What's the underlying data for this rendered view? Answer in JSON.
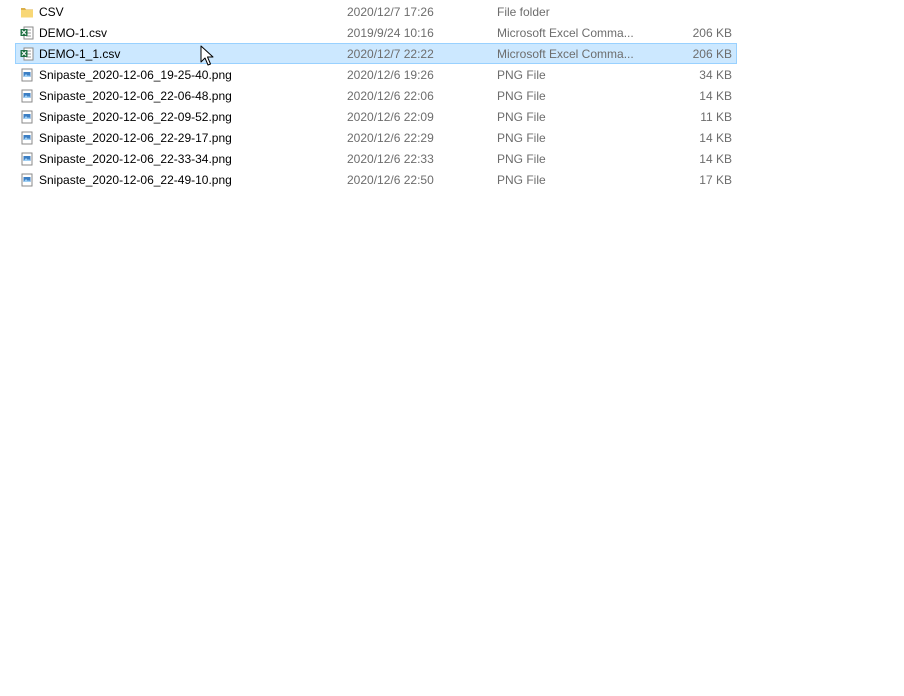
{
  "files": [
    {
      "name": "CSV",
      "date": "2020/12/7 17:26",
      "type": "File folder",
      "size": "",
      "icon": "folder-icon",
      "selected": false
    },
    {
      "name": "DEMO-1.csv",
      "date": "2019/9/24 10:16",
      "type": "Microsoft Excel Comma...",
      "size": "206 KB",
      "icon": "excel-csv-icon",
      "selected": false
    },
    {
      "name": "DEMO-1_1.csv",
      "date": "2020/12/7 22:22",
      "type": "Microsoft Excel Comma...",
      "size": "206 KB",
      "icon": "excel-csv-icon",
      "selected": true
    },
    {
      "name": "Snipaste_2020-12-06_19-25-40.png",
      "date": "2020/12/6 19:26",
      "type": "PNG File",
      "size": "34 KB",
      "icon": "png-image-icon",
      "selected": false
    },
    {
      "name": "Snipaste_2020-12-06_22-06-48.png",
      "date": "2020/12/6 22:06",
      "type": "PNG File",
      "size": "14 KB",
      "icon": "png-image-icon",
      "selected": false
    },
    {
      "name": "Snipaste_2020-12-06_22-09-52.png",
      "date": "2020/12/6 22:09",
      "type": "PNG File",
      "size": "11 KB",
      "icon": "png-image-icon",
      "selected": false
    },
    {
      "name": "Snipaste_2020-12-06_22-29-17.png",
      "date": "2020/12/6 22:29",
      "type": "PNG File",
      "size": "14 KB",
      "icon": "png-image-icon",
      "selected": false
    },
    {
      "name": "Snipaste_2020-12-06_22-33-34.png",
      "date": "2020/12/6 22:33",
      "type": "PNG File",
      "size": "14 KB",
      "icon": "png-image-icon",
      "selected": false
    },
    {
      "name": "Snipaste_2020-12-06_22-49-10.png",
      "date": "2020/12/6 22:50",
      "type": "PNG File",
      "size": "17 KB",
      "icon": "png-image-icon",
      "selected": false
    }
  ],
  "colors": {
    "selection_bg": "#cce8ff",
    "selection_border": "#99d1ff",
    "secondary_text": "#6d6d6d",
    "folder": "#f8d775",
    "excel_green": "#1d6f42",
    "image_blue": "#3c7fc4"
  }
}
